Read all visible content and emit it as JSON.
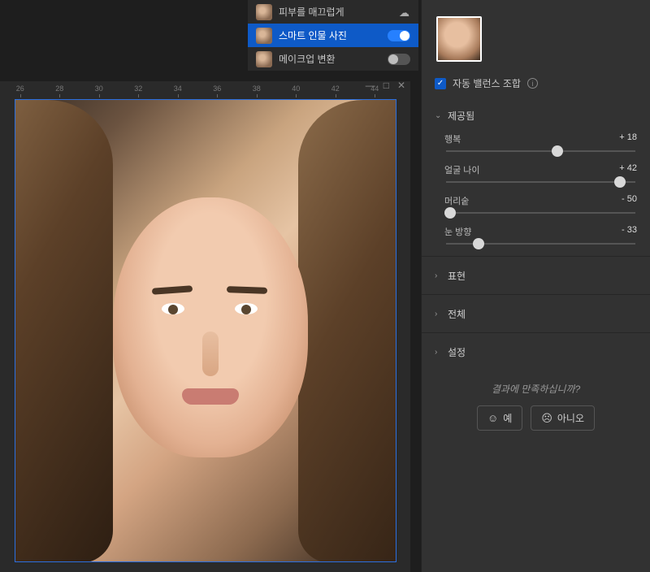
{
  "filters": [
    {
      "label": "피부를 매끄럽게",
      "active": false,
      "icon": "cloud"
    },
    {
      "label": "스마트 인물 사진",
      "active": true,
      "toggle": true
    },
    {
      "label": "메이크업 변환",
      "active": false,
      "toggle": false
    }
  ],
  "ruler_ticks": [
    "26",
    "28",
    "30",
    "32",
    "34",
    "36",
    "38",
    "40",
    "42",
    "44"
  ],
  "window_controls": {
    "minimize": "—",
    "maximize": "□",
    "close": "✕"
  },
  "autobalance": {
    "label": "자동 밸런스 조합",
    "checked": true
  },
  "sections": {
    "provided": {
      "label": "제공됨",
      "expanded": true
    },
    "expression": {
      "label": "표현"
    },
    "global": {
      "label": "전체"
    },
    "settings": {
      "label": "설정"
    }
  },
  "sliders": [
    {
      "label": "행복",
      "value": "+ 18",
      "pos": 59
    },
    {
      "label": "얼굴 나이",
      "value": "+ 42",
      "pos": 92
    },
    {
      "label": "머리숱",
      "value": "- 50",
      "pos": 2
    },
    {
      "label": "눈 방향",
      "value": "- 33",
      "pos": 17
    }
  ],
  "feedback": {
    "question": "결과에 만족하십니까?",
    "yes": "예",
    "no": "아니오"
  }
}
